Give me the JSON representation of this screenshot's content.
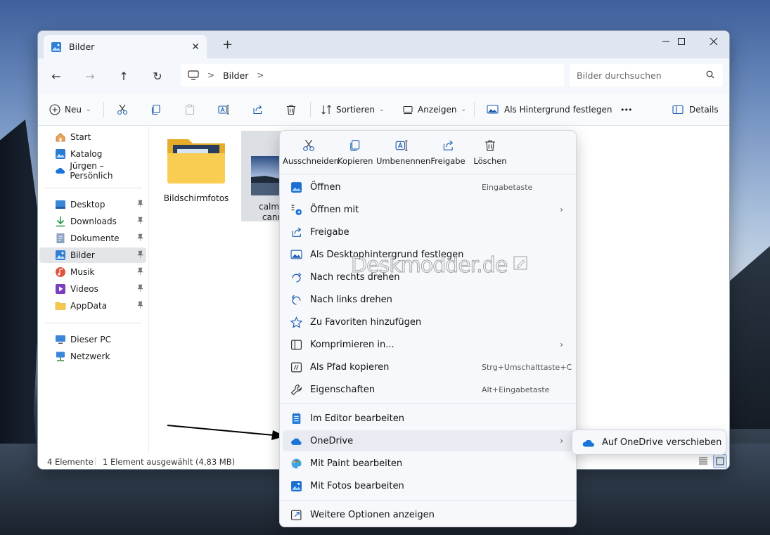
{
  "window": {
    "tab_title": "Bilder",
    "new_tab_symbol": "+",
    "minimize_symbol": "—",
    "maximize_symbol": "☐",
    "close_symbol": "✕"
  },
  "nav": {
    "back_symbol": "←",
    "forward_symbol": "→",
    "up_symbol": "↑",
    "refresh_symbol": "↻",
    "breadcrumb_sep1": ">",
    "breadcrumb_current": "Bilder",
    "breadcrumb_sep2": ">",
    "search_placeholder": "Bilder durchsuchen"
  },
  "toolbar": {
    "new_label": "Neu",
    "sort_label": "Sortieren",
    "view_label": "Anzeigen",
    "background_label": "Als Hintergrund festlegen",
    "more_label": "•••",
    "details_label": "Details"
  },
  "sidebar": {
    "quick": [
      {
        "label": "Start"
      },
      {
        "label": "Katalog"
      },
      {
        "label": "Jürgen – Persönlich"
      }
    ],
    "pinned": [
      {
        "label": "Desktop"
      },
      {
        "label": "Downloads"
      },
      {
        "label": "Dokumente"
      },
      {
        "label": "Bilder"
      },
      {
        "label": "Musik"
      },
      {
        "label": "Videos"
      },
      {
        "label": "AppData"
      }
    ],
    "system": [
      {
        "label": "Dieser PC"
      },
      {
        "label": "Netzwerk"
      }
    ],
    "pin_symbol": "📌"
  },
  "files": [
    {
      "name": "Bildschirmfotos"
    },
    {
      "name_line1": "calm_sur",
      "name_line2": "cannab"
    }
  ],
  "status": {
    "count": "4 Elemente",
    "selection": "1 Element ausgewählt (4,83 MB)"
  },
  "context_menu": {
    "quick_actions": [
      {
        "label": "Ausschneiden"
      },
      {
        "label": "Kopieren"
      },
      {
        "label": "Umbenennen"
      },
      {
        "label": "Freigabe"
      },
      {
        "label": "Löschen"
      }
    ],
    "items": [
      {
        "label": "Öffnen",
        "accelerator": "Eingabetaste"
      },
      {
        "label": "Öffnen mit",
        "submenu": "›"
      },
      {
        "label": "Freigabe"
      },
      {
        "label": "Als Desktophintergrund festlegen"
      },
      {
        "label": "Nach rechts drehen"
      },
      {
        "label": "Nach links drehen"
      },
      {
        "label": "Zu Favoriten hinzufügen"
      },
      {
        "label": "Komprimieren in...",
        "submenu": "›"
      },
      {
        "label": "Als Pfad kopieren",
        "accelerator": "Strg+Umschalttaste+C"
      },
      {
        "label": "Eigenschaften",
        "accelerator": "Alt+Eingabetaste"
      },
      {
        "label": "Im Editor bearbeiten"
      },
      {
        "label": "OneDrive",
        "submenu": "›"
      },
      {
        "label": "Mit Paint bearbeiten"
      },
      {
        "label": "Mit Fotos bearbeiten"
      },
      {
        "label": "Weitere Optionen anzeigen"
      }
    ]
  },
  "onedrive_submenu": {
    "label": "Auf OneDrive verschieben"
  },
  "watermark": "Deskmodder.de",
  "colors": {
    "accent": "#0067c0",
    "folder": "#f5c94c",
    "onedrive": "#1a73d9"
  }
}
